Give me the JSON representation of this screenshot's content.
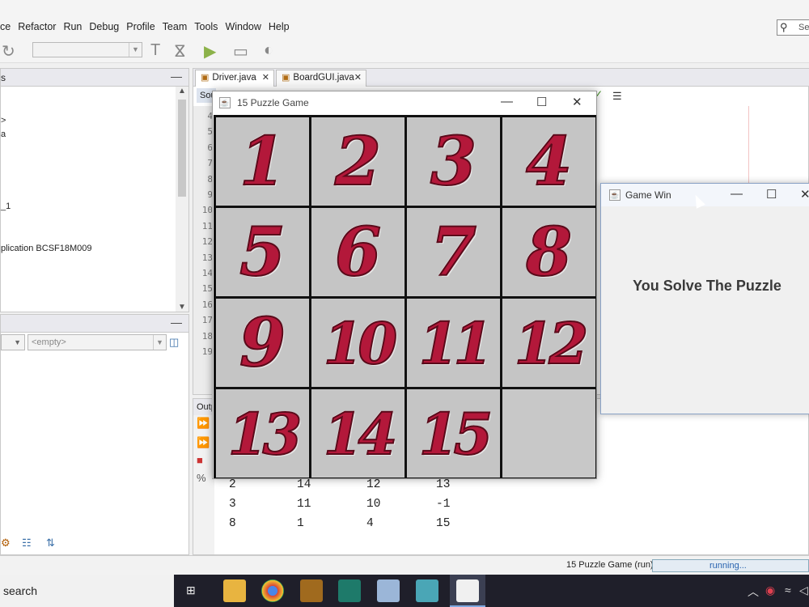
{
  "ide": {
    "menus": [
      "ce",
      "Refactor",
      "Run",
      "Debug",
      "Profile",
      "Team",
      "Tools",
      "Window",
      "Help"
    ],
    "search_text": "Se",
    "projects_header": "s",
    "tree": [
      ">",
      "a",
      "_1",
      "plication BCSF18M009"
    ],
    "navigator_combo": "<empty>",
    "tabs": [
      "Driver.java",
      "BoardGUI.java"
    ],
    "source_tab": "Sou",
    "output_tab": "Outp",
    "line_numbers": [
      "4",
      "5",
      "6",
      "7",
      "8",
      "9",
      "10",
      "11",
      "12",
      "13",
      "14",
      "15",
      "16",
      "17",
      "18",
      "19"
    ],
    "output_rows": [
      [
        "2",
        "14",
        "12",
        "13"
      ],
      [
        "3",
        "11",
        "10",
        "-1"
      ],
      [
        "8",
        "1",
        "4",
        "15"
      ]
    ],
    "status": {
      "run_label": "15 Puzzle Game (run)",
      "progress_text": "running..."
    }
  },
  "taskbar": {
    "search_label": "search"
  },
  "puzzle": {
    "title": "15 Puzzle Game",
    "tiles": [
      "1",
      "2",
      "3",
      "4",
      "5",
      "6",
      "7",
      "8",
      "9",
      "10",
      "11",
      "12",
      "13",
      "14",
      "15",
      ""
    ]
  },
  "dialog": {
    "title": "Game Win",
    "message": "You Solve The Puzzle"
  },
  "colors": {
    "tile_number": "#b3183a",
    "tile_bg": "#c5c5c5",
    "board_grid": "#111111"
  }
}
